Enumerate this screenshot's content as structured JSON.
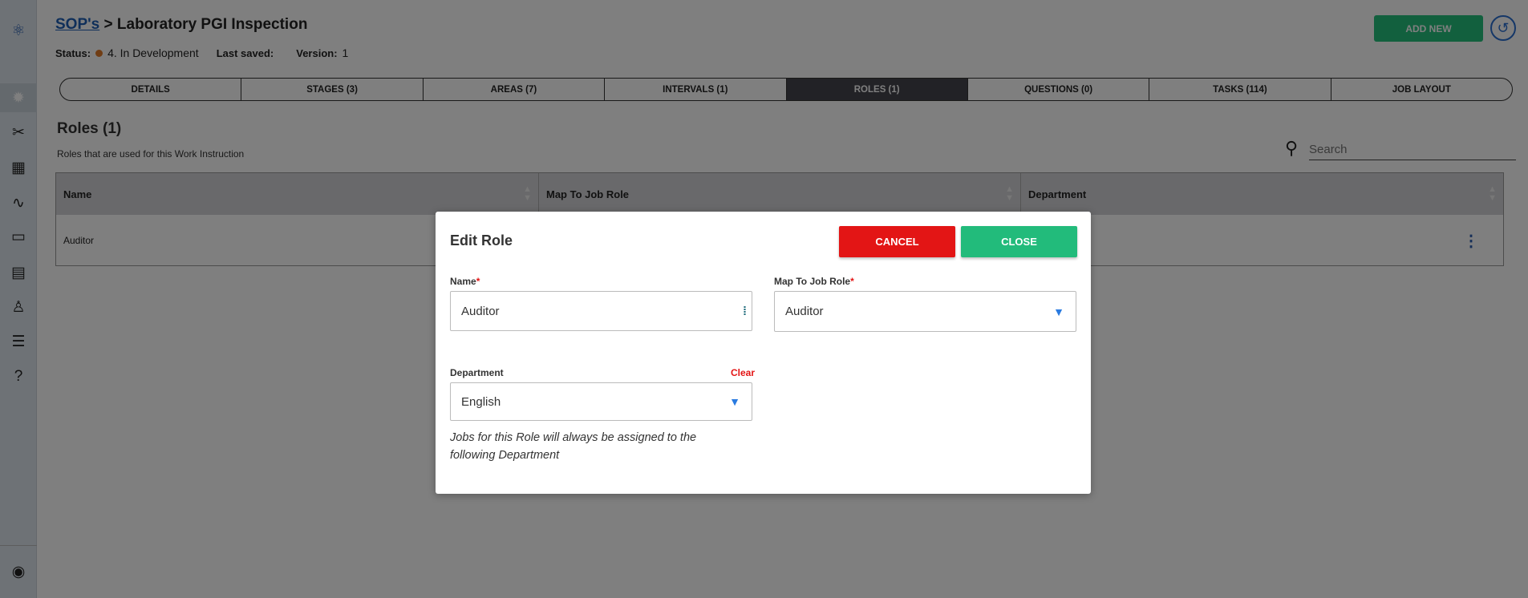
{
  "breadcrumb": {
    "root": "SOP's",
    "separator": ">",
    "title": "Laboratory PGI Inspection"
  },
  "status": {
    "label": "Status:",
    "value": "4. In Development",
    "last_saved_label": "Last saved:",
    "version_label": "Version:",
    "version": "1",
    "dot_color": "#e07a28"
  },
  "header": {
    "add_new": "ADD NEW"
  },
  "tabs": [
    "DETAILS",
    "STAGES (3)",
    "AREAS (7)",
    "INTERVALS (1)",
    "ROLES (1)",
    "QUESTIONS (0)",
    "TASKS (114)",
    "JOB LAYOUT"
  ],
  "active_tab": "ROLES (1)",
  "section": {
    "title": "Roles (1)",
    "subtitle": "Roles that are used for this Work Instruction"
  },
  "search": {
    "placeholder": "Search"
  },
  "table": {
    "columns": [
      "Name",
      "Map To Job Role",
      "Department"
    ],
    "rows": [
      [
        "Auditor",
        "",
        ""
      ]
    ]
  },
  "modal": {
    "title": "Edit Role",
    "cancel": "CANCEL",
    "close": "CLOSE",
    "name_label": "Name",
    "name_value": "Auditor",
    "map_label": "Map To Job Role",
    "map_value": "Auditor",
    "dept_label": "Department",
    "dept_clear": "Clear",
    "dept_value": "English",
    "required_mark": "*",
    "help": "Jobs for this Role will always be assigned to the following Department"
  }
}
